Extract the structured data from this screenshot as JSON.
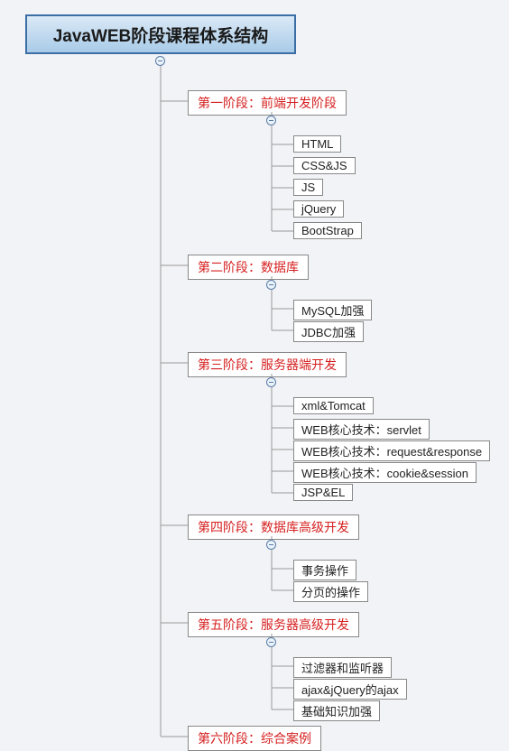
{
  "root": "JavaWEB阶段课程体系结构",
  "stages": [
    {
      "title": "第一阶段：前端开发阶段",
      "children": [
        "HTML",
        "CSS&JS",
        "JS",
        "jQuery",
        "BootStrap"
      ]
    },
    {
      "title": "第二阶段：数据库",
      "children": [
        "MySQL加强",
        "JDBC加强"
      ]
    },
    {
      "title": "第三阶段：服务器端开发",
      "children": [
        "xml&Tomcat",
        "WEB核心技术：servlet",
        "WEB核心技术：request&response",
        "WEB核心技术：cookie&session",
        "JSP&EL"
      ]
    },
    {
      "title": "第四阶段：数据库高级开发",
      "children": [
        "事务操作",
        "分页的操作"
      ]
    },
    {
      "title": "第五阶段：服务器高级开发",
      "children": [
        "过滤器和监听器",
        "ajax&jQuery的ajax",
        "基础知识加强"
      ]
    },
    {
      "title": "第六阶段：综合案例",
      "children": []
    }
  ]
}
